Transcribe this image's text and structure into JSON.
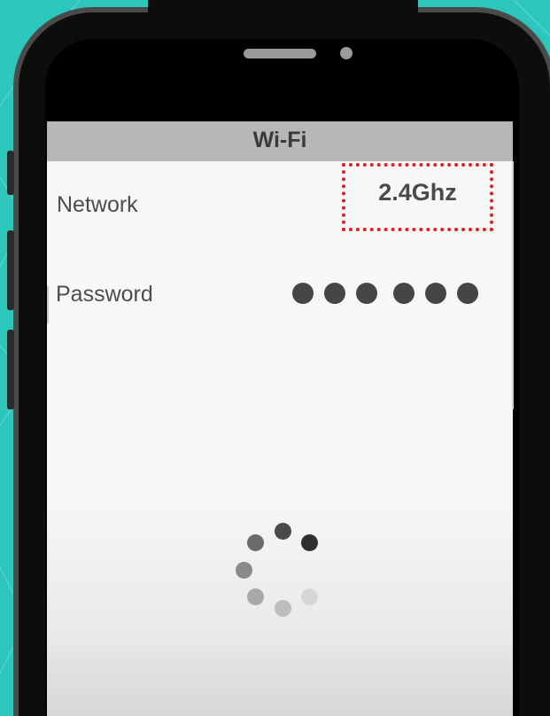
{
  "screen": {
    "title": "Wi-Fi"
  },
  "form": {
    "network_label": "Network",
    "network_value": "2.4Ghz",
    "password_label": "Password",
    "password_mask_count": 6
  },
  "icons": {
    "loading": "loading-spinner-icon"
  },
  "colors": {
    "background": "#2cc6bc",
    "highlight_border": "#e02020",
    "header_bar": "#b7b7b7"
  }
}
